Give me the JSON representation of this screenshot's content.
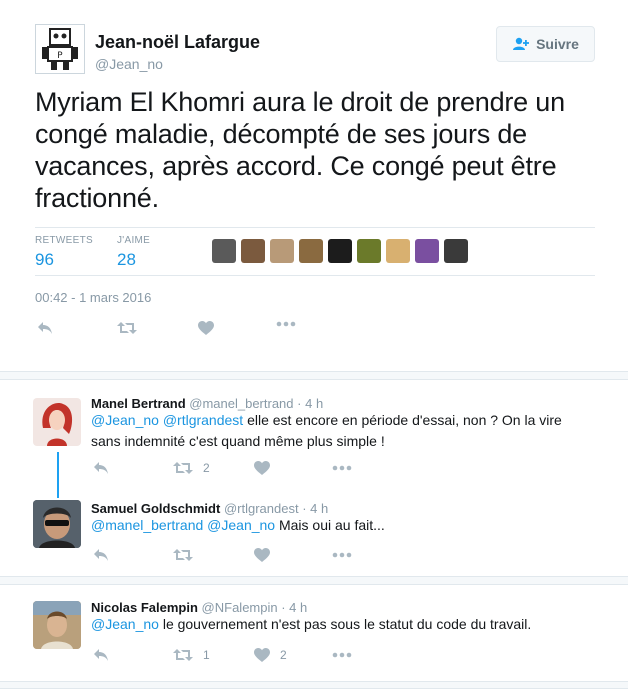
{
  "tweet": {
    "author_name": "Jean-noël Lafargue",
    "author_handle": "@Jean_no",
    "follow_label": "Suivre",
    "text": "Myriam El Khomri aura le droit de prendre un congé maladie, décompté de ses jours de vacances, après accord. Ce congé peut être fractionné.",
    "retweets_label": "RETWEETS",
    "retweets_count": "96",
    "likes_label": "J'AIME",
    "likes_count": "28",
    "timestamp": "00:42 - 1 mars 2016",
    "liker_face_colors": [
      "#5a5a5a",
      "#7b5a3e",
      "#b89a78",
      "#8a6a40",
      "#1c1c1c",
      "#6b7a2a",
      "#d8b070",
      "#7a4fa0",
      "#3a3a3a"
    ]
  },
  "replies": [
    {
      "name": "Manel Bertrand",
      "handle": "@manel_bertrand",
      "time": "· 4 h",
      "mentions": "@Jean_no @rtlgrandest",
      "text_line1_rest": " elle est encore en période d'essai, non ? On la vire",
      "text_line2": "sans indemnité c'est quand même plus simple !",
      "retweets": "2",
      "likes": ""
    },
    {
      "name": "Samuel Goldschmidt",
      "handle": "@rtlgrandest",
      "time": "· 4 h",
      "mentions": "@manel_bertrand @Jean_no",
      "text_rest": " Mais oui au fait...",
      "retweets": "",
      "likes": ""
    },
    {
      "name": "Nicolas Falempin",
      "handle": "@NFalempin",
      "time": "· 4 h",
      "mentions": "@Jean_no",
      "text_rest": " le gouvernement n'est pas sous le statut du code du travail.",
      "retweets": "1",
      "likes": "2"
    }
  ],
  "icons": [
    "reply-icon",
    "retweet-icon",
    "like-icon",
    "more-icon",
    "add-user-icon"
  ]
}
